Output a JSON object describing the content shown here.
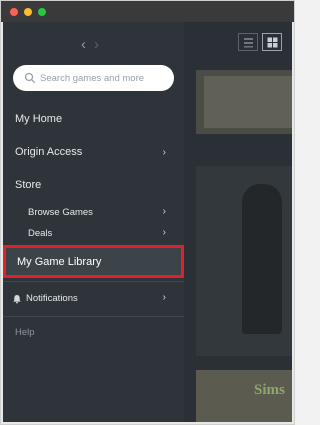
{
  "search": {
    "placeholder": "Search games and more"
  },
  "nav": {
    "my_home": "My Home",
    "origin_access": "Origin Access",
    "store": "Store",
    "browse_games": "Browse Games",
    "deals": "Deals",
    "my_game_library": "My Game Library",
    "notifications": "Notifications",
    "help": "Help"
  },
  "icons": {
    "back": "chevron-left-icon",
    "forward": "chevron-right-icon",
    "search": "search-icon",
    "bell": "bell-icon",
    "grid": "grid-view-icon",
    "list": "list-view-icon"
  },
  "main": {
    "banner_fragment": "Sims"
  },
  "colors": {
    "sidebar_bg": "#2e3439",
    "highlight_border": "#e0212b",
    "highlight_bg": "#3d4449",
    "text": "#e6e9ec",
    "muted": "#8e979f"
  }
}
